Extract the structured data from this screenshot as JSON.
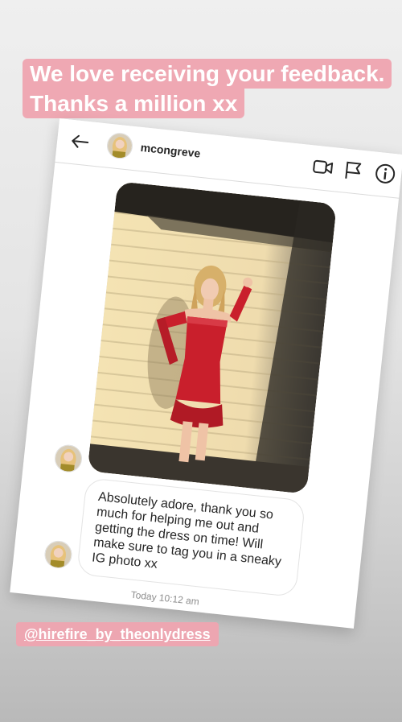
{
  "caption": {
    "line1": "We love receiving your feedback.",
    "line2": "Thanks a million xx"
  },
  "dm": {
    "header": {
      "username": "mcongreve",
      "icons": [
        "back-arrow-icon",
        "video-camera-icon",
        "flag-icon",
        "info-icon"
      ]
    },
    "message_text": "Absolutely adore, thank you so much for helping me out and getting the dress on time! Will make sure to tag you in a sneaky IG photo xx",
    "timestamp": "Today 10:12 am"
  },
  "handle": "@hirefire_by_theonlydress",
  "colors": {
    "caption_bg": "#efa4b0",
    "dress": "#c91f2c",
    "text_dark": "#262626",
    "text_muted": "#8e8e8e"
  }
}
